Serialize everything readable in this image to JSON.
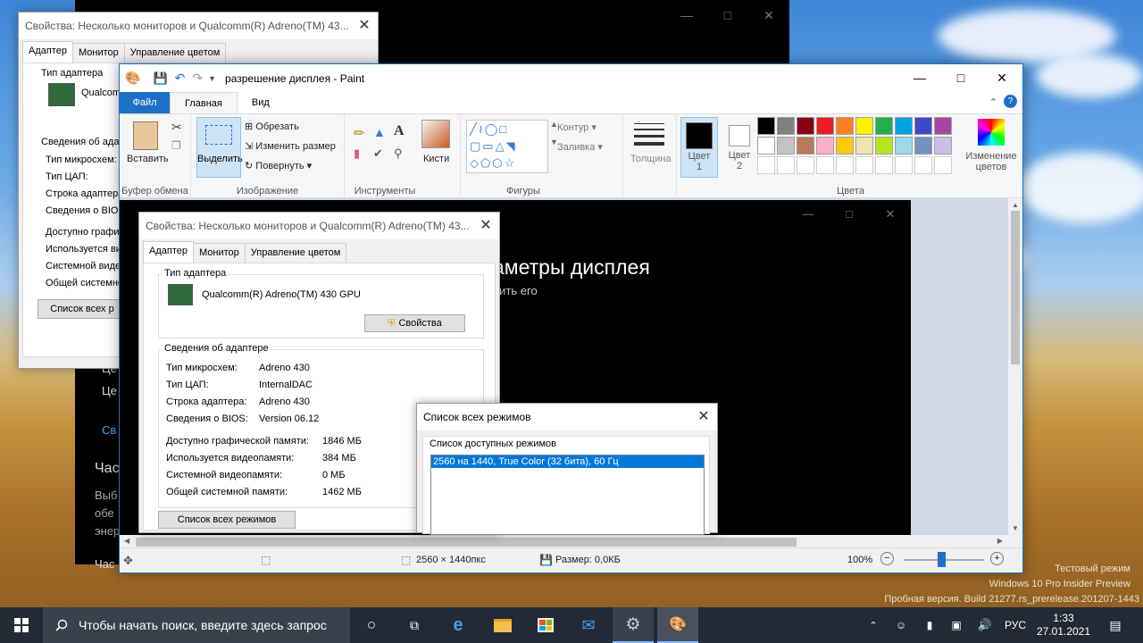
{
  "back_dialog": {
    "title": "Свойства: Несколько мониторов и Qualcomm(R) Adreno(TM) 43...",
    "tabs": [
      "Адаптер",
      "Монитор",
      "Управление цветом"
    ],
    "adapter_type_label": "Тип адаптера",
    "adapter_name_fragment": "Qualcomm",
    "info_label": "Сведения об адаптере",
    "rows": [
      "Тип микросхем:",
      "Тип ЦАП:",
      "Строка адаптера:",
      "Сведения о BIOS",
      "Доступно графич",
      "Используется вид",
      "Системной видео",
      "Общей системной"
    ],
    "list_modes_button": "Список всех р"
  },
  "dark_window": {
    "heading_fragment": "аметры дисплея",
    "sub_fragment": "нить его",
    "left_items": [
      "Це",
      "Це",
      "Св",
      "Час",
      "Выб",
      "обе",
      "энер",
      "Час"
    ]
  },
  "paint": {
    "title": "разрешение дисплея - Paint",
    "tabs": {
      "file": "Файл",
      "home": "Главная",
      "view": "Вид"
    },
    "groups": {
      "clipboard": "Буфер обмена",
      "image": "Изображение",
      "tools": "Инструменты",
      "shapes": "Фигуры",
      "colors": "Цвета"
    },
    "paste": "Вставить",
    "select": "Выделить",
    "crop": "Обрезать",
    "resize": "Изменить размер",
    "rotate": "Повернуть",
    "brushes": "Кисти",
    "outline": "Контур",
    "fill": "Заливка",
    "size": "Толщина",
    "color1": "Цвет 1",
    "color1_a": "Цвет",
    "color1_b": "1",
    "color2_a": "Цвет",
    "color2_b": "2",
    "edit_colors_a": "Изменение",
    "edit_colors_b": "цветов",
    "palette_row1": [
      "#000000",
      "#7f7f7f",
      "#880015",
      "#ed1c24",
      "#ff7f27",
      "#fff200",
      "#22b14c",
      "#00a2e8",
      "#3f48cc",
      "#a349a4"
    ],
    "palette_row2": [
      "#ffffff",
      "#c3c3c3",
      "#b97a57",
      "#ffaec9",
      "#ffc90e",
      "#efe4b0",
      "#b5e61d",
      "#99d9ea",
      "#7092be",
      "#c8bfe7"
    ],
    "status": {
      "dimensions": "2560 × 1440пкс",
      "size": "Размер: 0,0КБ",
      "zoom": "100%"
    }
  },
  "inner_dialog": {
    "title": "Свойства: Несколько мониторов и Qualcomm(R) Adreno(TM) 43...",
    "tabs": [
      "Адаптер",
      "Монитор",
      "Управление цветом"
    ],
    "adapter_type_label": "Тип адаптера",
    "adapter_name": "Qualcomm(R) Adreno(TM) 430 GPU",
    "properties_button": "Свойства",
    "info_label": "Сведения об адаптере",
    "info": [
      {
        "k": "Тип микросхем:",
        "v": "Adreno 430"
      },
      {
        "k": "Тип ЦАП:",
        "v": "InternalDAC"
      },
      {
        "k": "Строка адаптера:",
        "v": "Adreno 430"
      },
      {
        "k": "Сведения о BIOS:",
        "v": "Version 06.12"
      }
    ],
    "memory": [
      {
        "k": "Доступно графической памяти:",
        "v": "1846 МБ"
      },
      {
        "k": "Используется видеопамяти:",
        "v": "384 МБ"
      },
      {
        "k": "Системной видеопамяти:",
        "v": "0 МБ"
      },
      {
        "k": "Общей системной памяти:",
        "v": "1462 МБ"
      }
    ],
    "list_modes_button": "Список всех режимов"
  },
  "modes_dialog": {
    "title": "Список всех режимов",
    "list_label": "Список доступных режимов",
    "selected_mode": "2560 на 1440, True Color (32 бита), 60 Гц"
  },
  "desktop_watermark": {
    "line1": "Тестовый режим",
    "line2": "Windows 10 Pro Insider Preview",
    "line3": "Пробная версия. Build 21277.rs_prerelease.201207-1443"
  },
  "taskbar": {
    "search_placeholder": "Чтобы начать поиск, введите здесь запрос",
    "language": "РУС",
    "time": "1:33",
    "date": "27.01.2021"
  }
}
